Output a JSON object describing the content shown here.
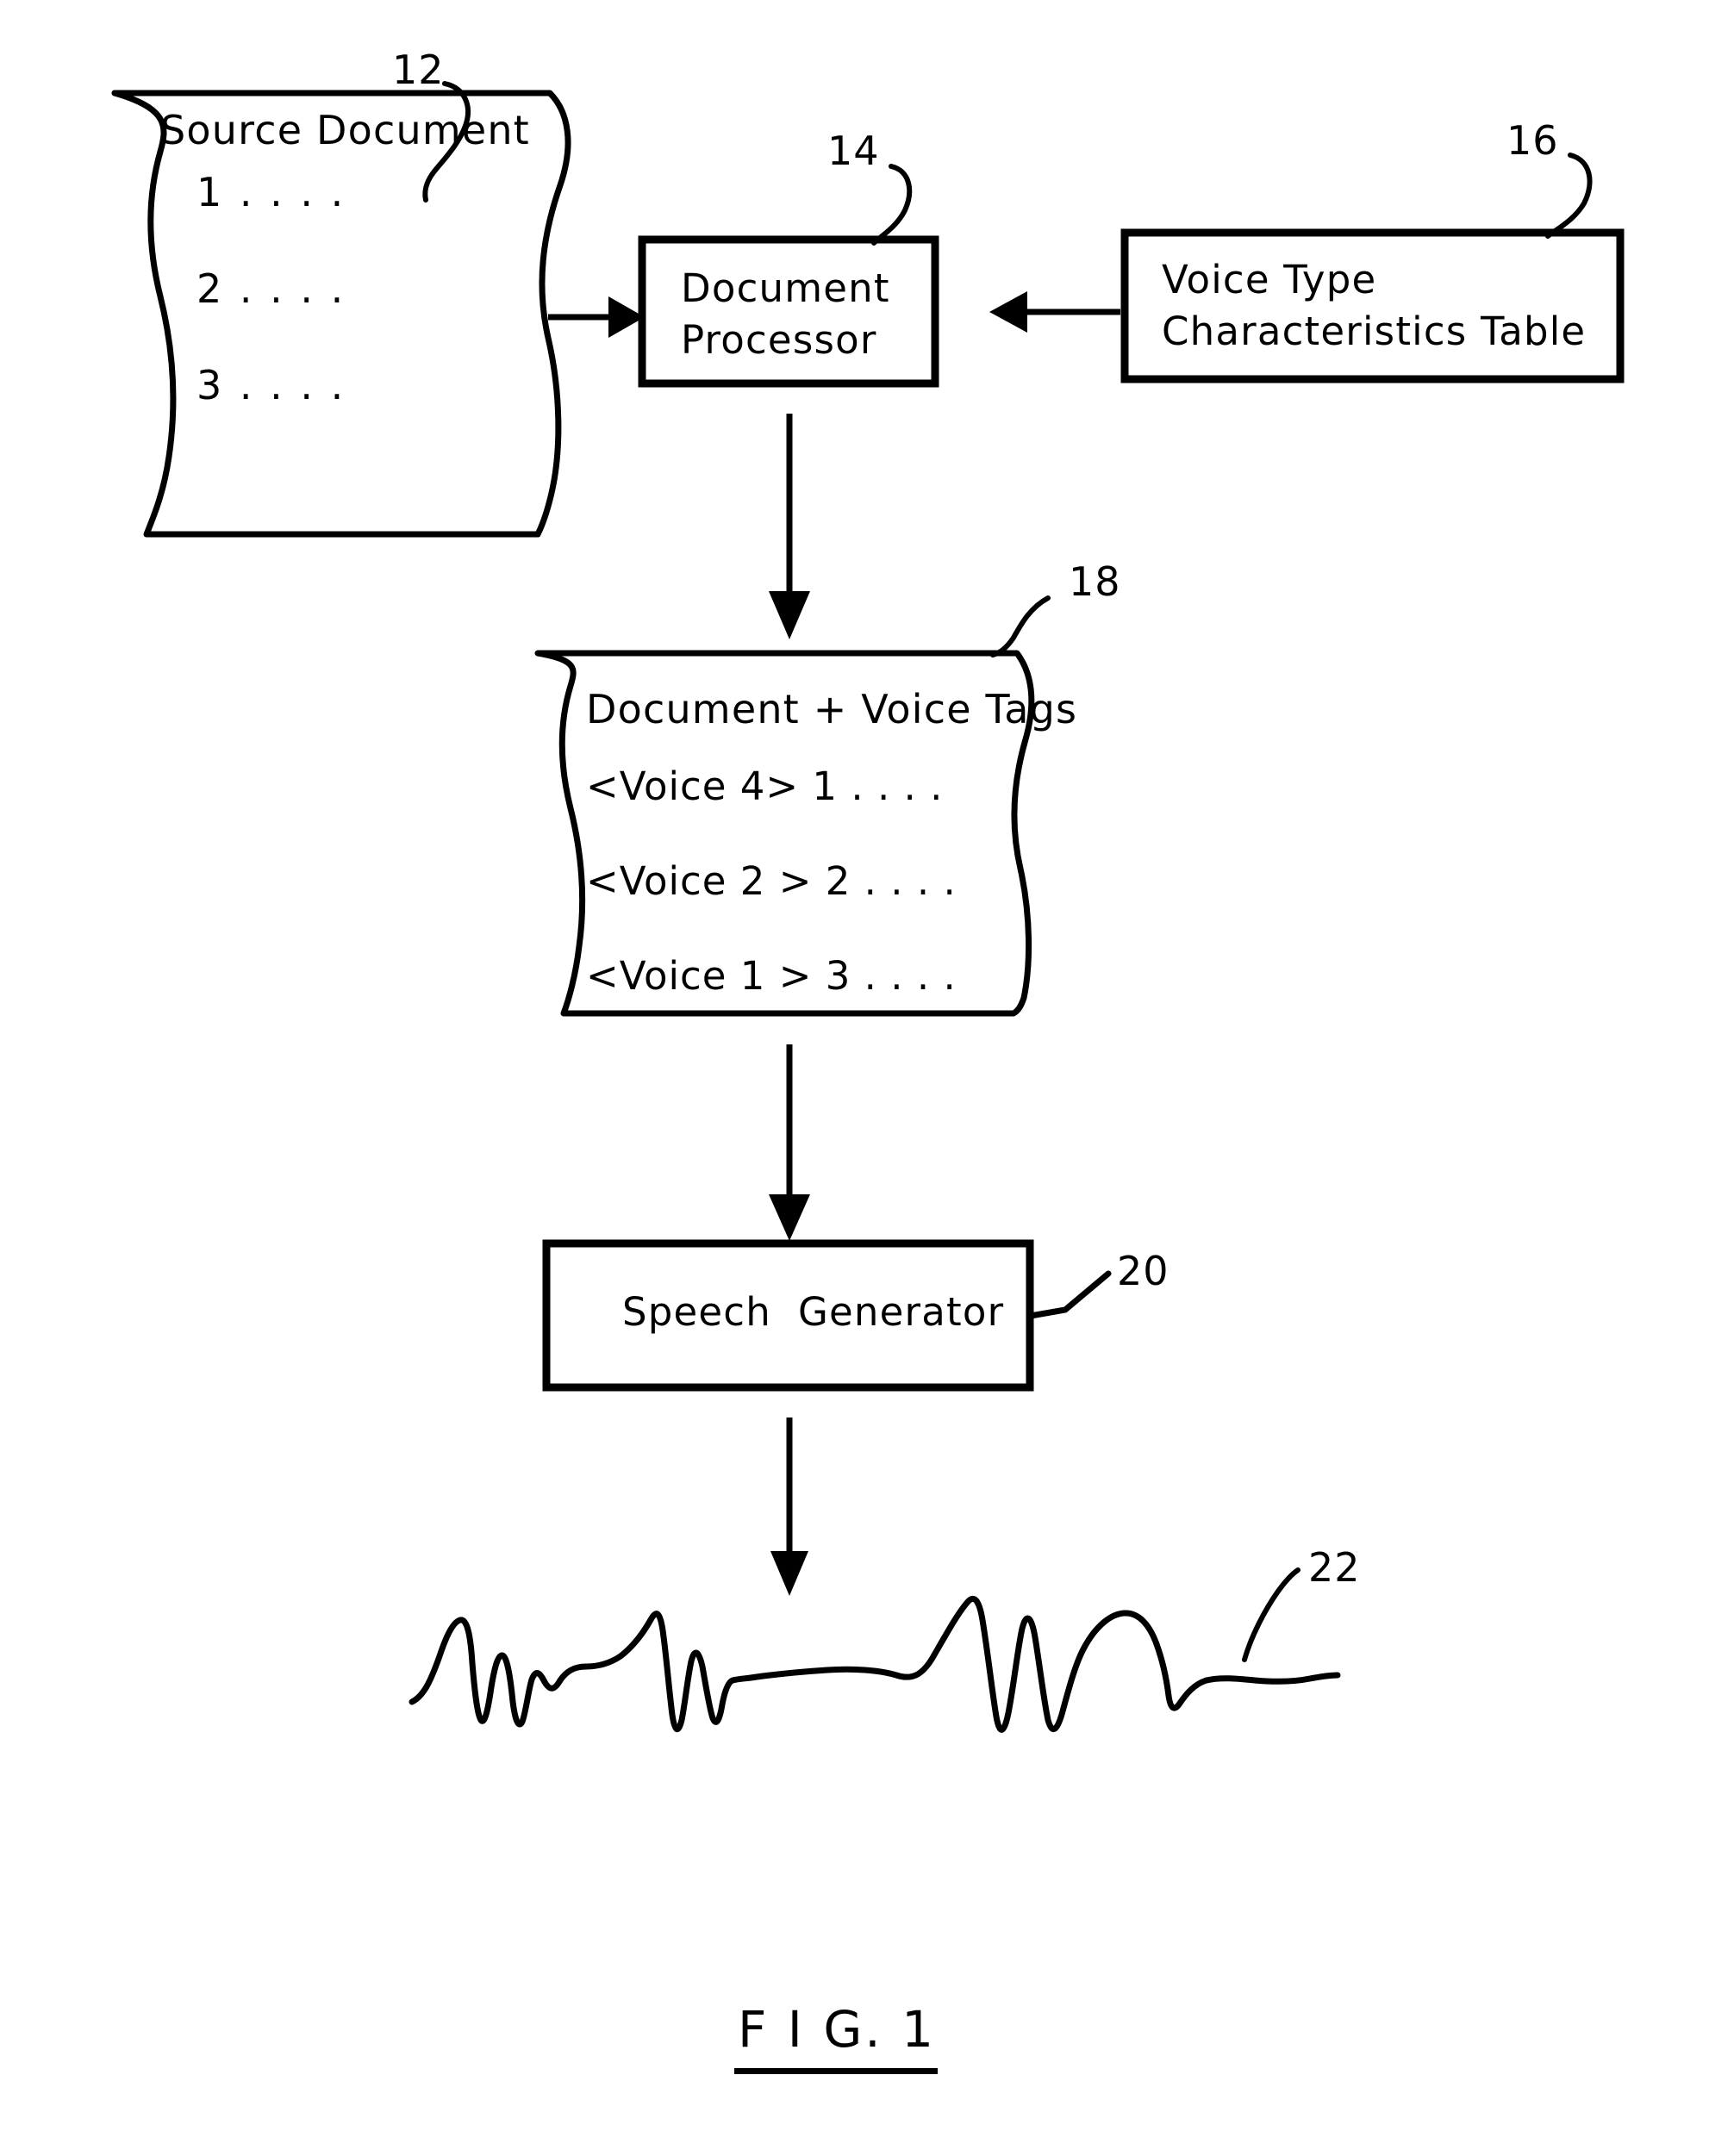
{
  "figure": {
    "caption": "F I G. 1"
  },
  "nodes": {
    "source_document": {
      "ref": "12",
      "title": "Source Document",
      "lines": [
        "1 . . . .",
        "2 . . . .",
        "3 . . . ."
      ]
    },
    "document_processor": {
      "ref": "14",
      "line1": "Document",
      "line2": "Processor"
    },
    "voice_table": {
      "ref": "16",
      "line1": "Voice Type",
      "line2": "Characteristics Table"
    },
    "tagged_document": {
      "ref": "18",
      "title": "Document + Voice Tags",
      "lines": [
        "<Voice 4> 1 . . . .",
        "<Voice 2 > 2 . . . .",
        "<Voice 1 > 3 . . . ."
      ]
    },
    "speech_generator": {
      "ref": "20",
      "label": "Speech  Generator"
    },
    "speech_waveform": {
      "ref": "22"
    }
  },
  "colors": {
    "ink": "#000000",
    "paper": "#ffffff"
  }
}
